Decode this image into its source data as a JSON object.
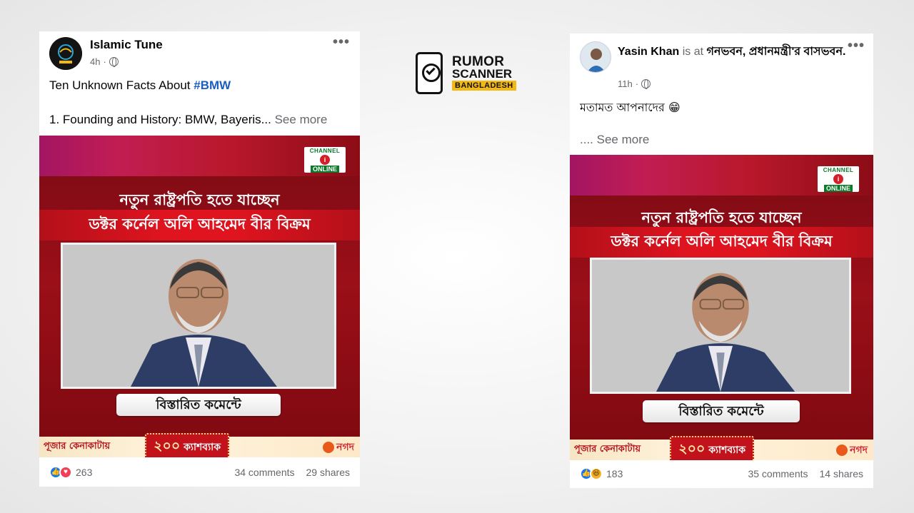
{
  "brand": {
    "line1": "RUMOR",
    "line2": "SCANNER",
    "line3": "BANGLADESH",
    "accent_color": "#f2b814"
  },
  "post1": {
    "author": "Islamic Tune",
    "time": "4h",
    "more_icon": "•••",
    "text_prefix": "Ten Unknown Facts About ",
    "hashtag": "#BMW",
    "text_line2": "1. Founding and History: BMW, Bayeris...",
    "see_more": "See more",
    "card": {
      "channel_top": "CHANNEL",
      "channel_num": "i",
      "channel_bottom": "ONLINE",
      "headline_1": "নতুন রাষ্ট্রপতি হতে যাচ্ছেন",
      "headline_2": "ডক্টর  কর্নেল অলি আহমেদ বীর বিক্রম",
      "detail_button": "বিস্তারিত কমেন্টে",
      "ad_left": "পূজার কেনাকাটায়",
      "ad_amount": "২০০",
      "ad_mid": "ক্যাশব্যাক",
      "ad_right": "নগদ"
    },
    "reaction_count": "263",
    "comments": "34 comments",
    "shares": "29 shares"
  },
  "post2": {
    "author": "Yasin Khan",
    "is_at": " is at ",
    "location": "গনভবন, প্রধানমন্ত্রী'র বাসভবন",
    "location_suffix": ".",
    "time": "11h",
    "more_icon": "•••",
    "text_line1": "মতামত আপনাদের 😁",
    "see_more": ".... See more",
    "card": {
      "channel_top": "CHANNEL",
      "channel_num": "i",
      "channel_bottom": "ONLINE",
      "headline_1": "নতুন রাষ্ট্রপতি হতে যাচ্ছেন",
      "headline_2": "ডক্টর  কর্নেল অলি আহমেদ বীর বিক্রম",
      "detail_button": "বিস্তারিত কমেন্টে",
      "ad_left": "পূজার কেনাকাটায়",
      "ad_amount": "২০০",
      "ad_mid": "ক্যাশব্যাক",
      "ad_right": "নগদ"
    },
    "reaction_count": "183",
    "comments": "35 comments",
    "shares": "14 shares"
  }
}
